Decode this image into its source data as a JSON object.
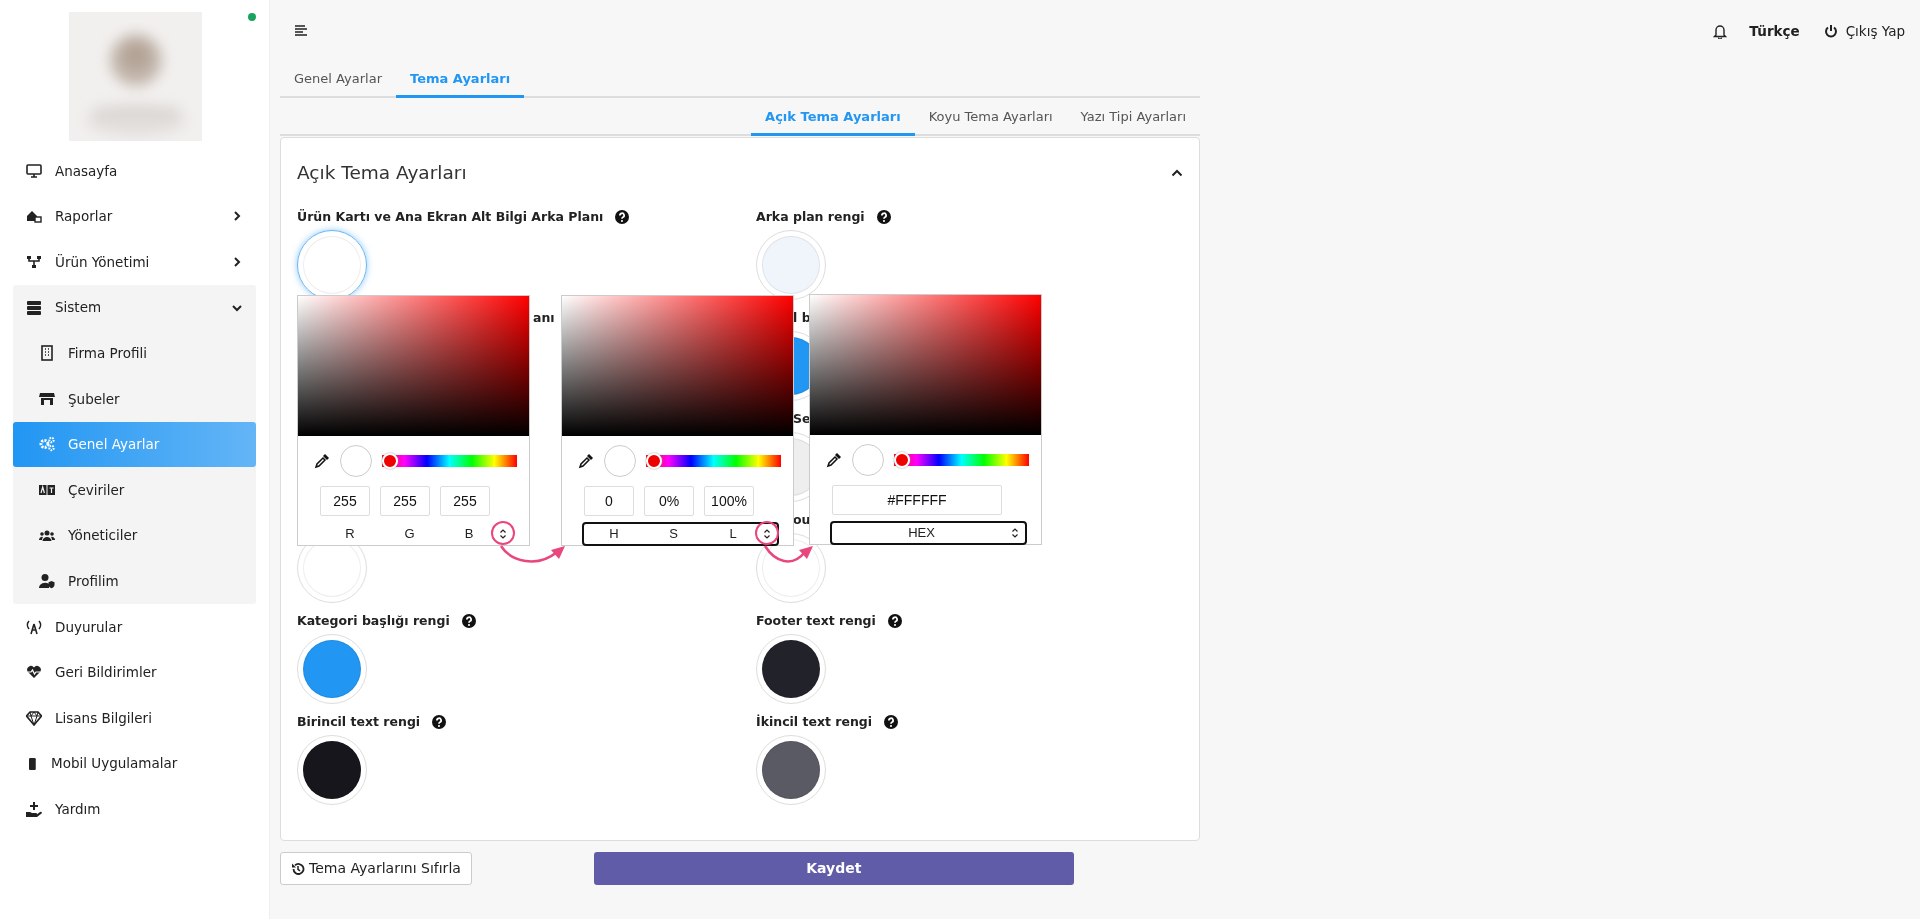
{
  "sidebar": {
    "online": true,
    "items": [
      {
        "label": "Anasayfa",
        "selected": false
      },
      {
        "label": "Raporlar",
        "selected": false,
        "expanded": false
      },
      {
        "label": "Ürün Yönetimi",
        "selected": false,
        "expanded": false
      },
      {
        "label": "Sistem",
        "selected": false,
        "expanded": true,
        "children": [
          {
            "label": "Firma Profili",
            "selected": false
          },
          {
            "label": "Şubeler",
            "selected": false
          },
          {
            "label": "Genel Ayarlar",
            "selected": true
          },
          {
            "label": "Çeviriler",
            "selected": false
          },
          {
            "label": "Yöneticiler",
            "selected": false
          },
          {
            "label": "Profilim",
            "selected": false
          }
        ]
      },
      {
        "label": "Duyurular",
        "selected": false
      },
      {
        "label": "Geri Bildirimler",
        "selected": false
      },
      {
        "label": "Lisans Bilgileri",
        "selected": false
      },
      {
        "label": "Mobil Uygulamalar",
        "selected": false
      },
      {
        "label": "Yardım",
        "selected": false
      }
    ]
  },
  "topbar": {
    "language": "Türkçe",
    "logout": "Çıkış Yap"
  },
  "tabs": [
    {
      "label": "Genel Ayarlar",
      "selected": false
    },
    {
      "label": "Tema Ayarları",
      "selected": true
    }
  ],
  "subtabs": [
    {
      "label": "Açık Tema Ayarları",
      "selected": true
    },
    {
      "label": "Koyu Tema Ayarları",
      "selected": false
    },
    {
      "label": "Yazı Tipi Ayarları",
      "selected": false
    }
  ],
  "panel": {
    "title": "Açık Tema Ayarları",
    "expanded": true,
    "rows": [
      [
        {
          "label": "Ürün Kartı ve Ana Ekran Alt Bilgi Arka Planı",
          "help": true,
          "color": "#ffffff",
          "focused": true
        },
        {
          "label": "Arka plan rengi",
          "help": true,
          "color": "#f0f4fb",
          "focused": false
        }
      ],
      [
        {
          "label": "anı",
          "covered": true
        },
        {
          "label": "l b",
          "covered": true,
          "color": "#2196f3",
          "focused": false
        }
      ],
      [
        null,
        {
          "label": "Se",
          "covered": true,
          "color": "#eeeeee",
          "focused": false
        }
      ],
      [
        {
          "color": "#ffffff",
          "focused": false
        },
        {
          "label": "ou",
          "covered": true,
          "color": "#ffffff",
          "focused": false
        }
      ],
      [
        {
          "label": "Kategori başlığı rengi",
          "help": true,
          "color": "#2196f3",
          "focused": false
        },
        {
          "label": "Footer text rengi",
          "help": true,
          "color": "#22222b",
          "focused": false
        }
      ],
      [
        {
          "label": "Birincil text rengi",
          "help": true,
          "color": "#16161c",
          "focused": false
        },
        {
          "label": "İkincil text rengi",
          "help": true,
          "color": "#5a5a64",
          "focused": false
        }
      ]
    ],
    "pickers": [
      {
        "kind": "channels",
        "level": 0,
        "inputs": [
          "255",
          "255",
          "255"
        ],
        "labels": [
          "R",
          "G",
          "B"
        ],
        "outlined": false,
        "annotated": true
      },
      {
        "kind": "channels",
        "level": 0,
        "inputs": [
          "0",
          "0%",
          "100%"
        ],
        "labels": [
          "H",
          "S",
          "L"
        ],
        "outlined": true,
        "annotated": true
      },
      {
        "kind": "hex",
        "level": 0,
        "inputs": [
          "#FFFFFF"
        ],
        "labels": [
          "HEX"
        ],
        "outlined": true,
        "annotated": false
      }
    ]
  },
  "buttons": {
    "reset": "Tema Ayarlarını Sıfırla",
    "save": "Kaydet"
  }
}
